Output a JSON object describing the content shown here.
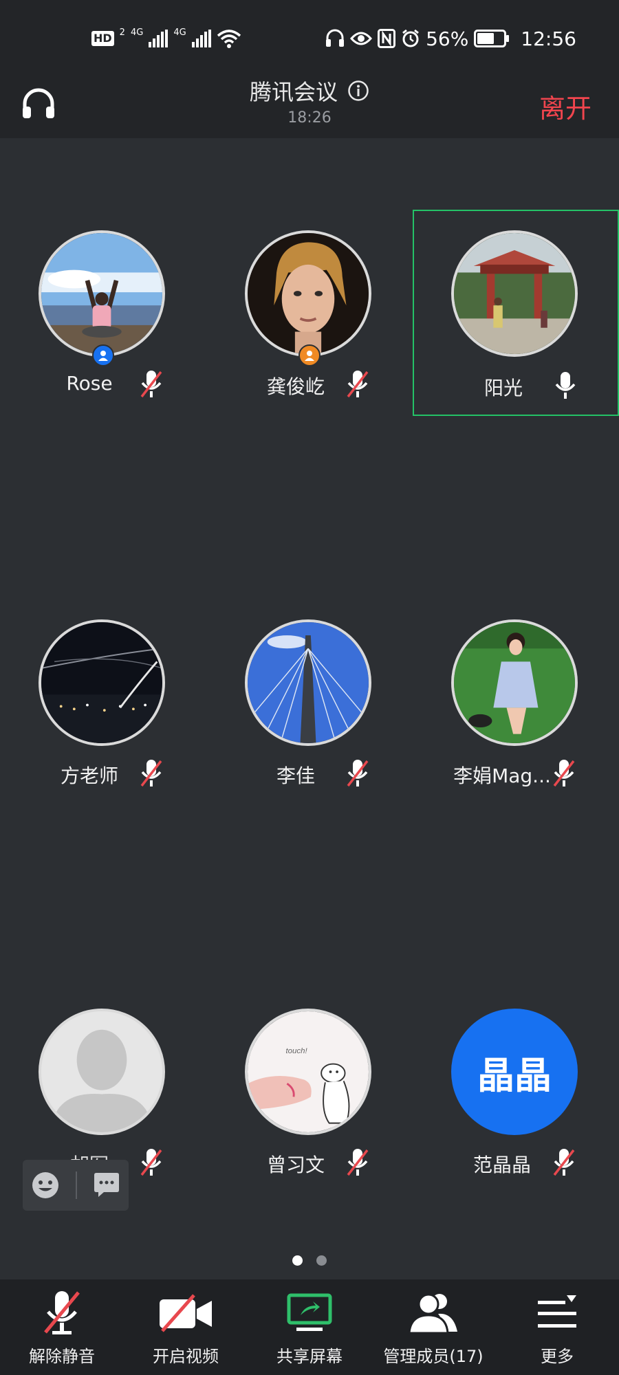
{
  "status_bar": {
    "hd_label": "HD",
    "hd_sim": "2",
    "net1": "4G",
    "net2": "4G",
    "battery": "56%",
    "time": "12:56"
  },
  "header": {
    "title": "腾讯会议",
    "timer": "18:26",
    "leave_label": "离开"
  },
  "participants": [
    {
      "name": "Rose",
      "mic": "muted",
      "badge": "host",
      "speaking": false
    },
    {
      "name": "龚俊屹",
      "mic": "muted",
      "badge": "cohost",
      "speaking": false
    },
    {
      "name": "阳光",
      "mic": "active",
      "badge": "",
      "speaking": true
    },
    {
      "name": "方老师",
      "mic": "muted",
      "badge": "",
      "speaking": false
    },
    {
      "name": "李佳",
      "mic": "muted",
      "badge": "",
      "speaking": false
    },
    {
      "name": "李娟Mag...",
      "mic": "muted",
      "badge": "",
      "speaking": false
    },
    {
      "name": "胡军",
      "mic": "muted",
      "badge": "",
      "speaking": false
    },
    {
      "name": "曾习文",
      "mic": "muted",
      "badge": "",
      "speaking": false
    },
    {
      "name": "范晶晶",
      "mic": "muted",
      "badge": "",
      "speaking": false,
      "avatar_text": "晶晶"
    }
  ],
  "pager": {
    "pages": 2,
    "current": 1
  },
  "toolbar": {
    "unmute": "解除静音",
    "start_video": "开启视频",
    "share_screen": "共享屏幕",
    "manage_members": "管理成员(17)",
    "more": "更多"
  },
  "colors": {
    "background": "#2c2f33",
    "header": "#232528",
    "toolbar": "#1f2124",
    "leave": "#f2454e",
    "speaking_border": "#24c267",
    "mute_slash": "#e8484e",
    "host_badge": "#1771f1",
    "cohost_badge": "#f08a24",
    "share_icon": "#2fbf6a"
  }
}
